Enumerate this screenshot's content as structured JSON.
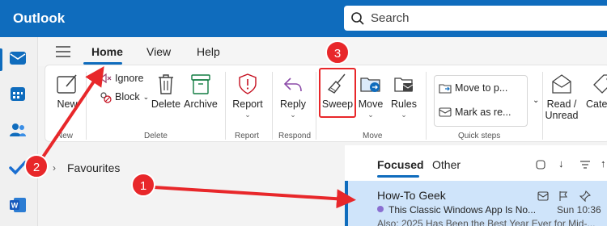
{
  "app": {
    "title": "Outlook"
  },
  "search": {
    "placeholder": "Search"
  },
  "tabs": {
    "items": [
      "Home",
      "View",
      "Help"
    ]
  },
  "ribbon": {
    "new_label": "New",
    "new_sub": "New",
    "ignore": "Ignore",
    "block": "Block",
    "delete": "Delete",
    "archive": "Archive",
    "group_delete": "Delete",
    "report": "Report",
    "group_report": "Report",
    "reply": "Reply",
    "group_respond": "Respond",
    "sweep": "Sweep",
    "move": "Move",
    "rules": "Rules",
    "group_move": "Move",
    "move_to": "Move to p...",
    "mark_as": "Mark as re...",
    "group_quick": "Quick steps",
    "read_unread_1": "Read /",
    "read_unread_2": "Unread",
    "categorize": "Catego"
  },
  "folders": {
    "favourites": "Favourites"
  },
  "mail_list": {
    "tab_focused": "Focused",
    "tab_other": "Other",
    "sender": "How-To Geek",
    "subject": "This Classic Windows App Is No...",
    "time": "Sun 10:36",
    "preview": "Also: 2025 Has Been the Best Year Ever for Mid-..."
  },
  "annotations": {
    "one": "1",
    "two": "2",
    "three": "3"
  },
  "colors": {
    "brand": "#0f6cbd",
    "annotation": "#e8272a",
    "selected_mail": "#cfe4fa"
  }
}
